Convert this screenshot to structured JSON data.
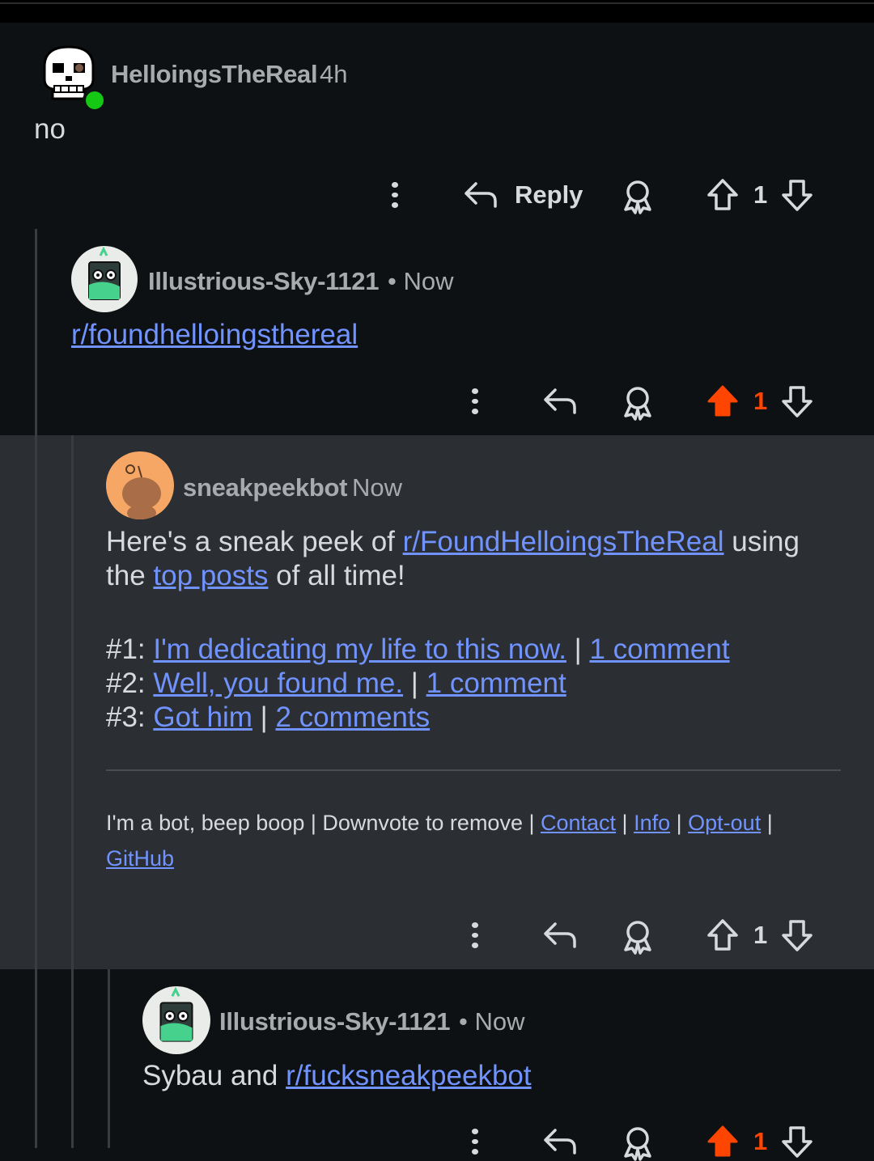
{
  "comments": [
    {
      "username": "HelloingsTheReal",
      "time": "4h",
      "body": "no",
      "actions": {
        "reply_label": "Reply",
        "vote_count": "1",
        "upvoted": false
      }
    },
    {
      "username": "Illustrious-Sky-1121",
      "time": "• Now",
      "body_link": "r/foundhelloingsthereal",
      "actions": {
        "vote_count": "1",
        "upvoted": true
      }
    },
    {
      "username": "sneakpeekbot",
      "time": "Now",
      "intro_1": "Here's a sneak peek of ",
      "intro_link": "r/FoundHelloingsTheReal",
      "intro_2": " using",
      "intro_3": "the ",
      "intro_link_2": "top posts",
      "intro_4": " of all time!",
      "posts": [
        {
          "rank": "#1: ",
          "title": "I'm dedicating my life to this now.",
          "sep": " | ",
          "comments": "1 comment"
        },
        {
          "rank": "#2: ",
          "title": "Well, you found me.",
          "sep": " | ",
          "comments": "1 comment"
        },
        {
          "rank": "#3: ",
          "title": "Got him",
          "sep": " | ",
          "comments": "2 comments"
        }
      ],
      "footer_text": "I'm a bot, beep boop | Downvote to remove | ",
      "footer_links": {
        "contact": "Contact",
        "info": "Info",
        "optout": "Opt-out",
        "github": "GitHub"
      },
      "footer_sep": " | ",
      "actions": {
        "vote_count": "1",
        "upvoted": false
      }
    },
    {
      "username": "Illustrious-Sky-1121",
      "time": "• Now",
      "body_1": "Sybau and ",
      "body_link": "r/fucksneakpeekbot",
      "actions": {
        "vote_count": "1",
        "upvoted": true
      }
    }
  ],
  "colors": {
    "upvote": "#ff4500",
    "link": "#7193ff",
    "online": "#14c814"
  }
}
